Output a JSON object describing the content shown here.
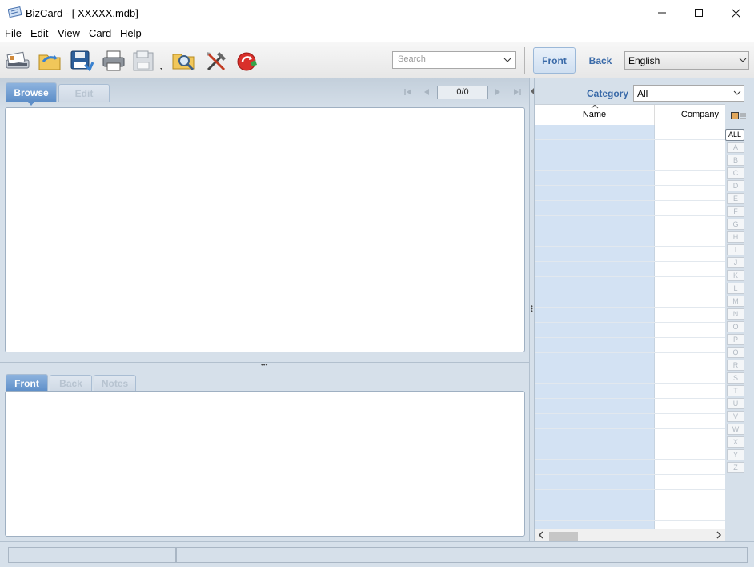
{
  "window": {
    "title": "BizCard - [ XXXXX.mdb]",
    "minimize": "—",
    "maximize": "☐",
    "close": "✕"
  },
  "menu": [
    "File",
    "Edit",
    "View",
    "Card",
    "Help"
  ],
  "toolbar": {
    "icons": [
      "scan-icon",
      "import-icon",
      "save-icon",
      "print-icon",
      "export-icon",
      "find-icon",
      "tools-icon",
      "recycle-icon"
    ],
    "search_placeholder": "Search",
    "front_label": "Front",
    "back_label": "Back",
    "language": "English"
  },
  "browse": {
    "tabs": [
      "Browse",
      "Edit"
    ],
    "record_counter": "0/0"
  },
  "detail": {
    "tabs": [
      "Front",
      "Back",
      "Notes"
    ]
  },
  "list": {
    "category_label": "Category",
    "category_value": "All",
    "columns": [
      "Name",
      "Company"
    ],
    "alphabet": [
      "ALL",
      "A",
      "B",
      "C",
      "D",
      "E",
      "F",
      "G",
      "H",
      "I",
      "J",
      "K",
      "L",
      "M",
      "N",
      "O",
      "P",
      "Q",
      "R",
      "S",
      "T",
      "U",
      "V",
      "W",
      "X",
      "Y",
      "Z"
    ]
  },
  "colors": {
    "accent": "#3a6aa8",
    "panel": "#d6e0ea",
    "active_tab": "#5d8ec8",
    "list_highlight": "#d3e2f3"
  }
}
